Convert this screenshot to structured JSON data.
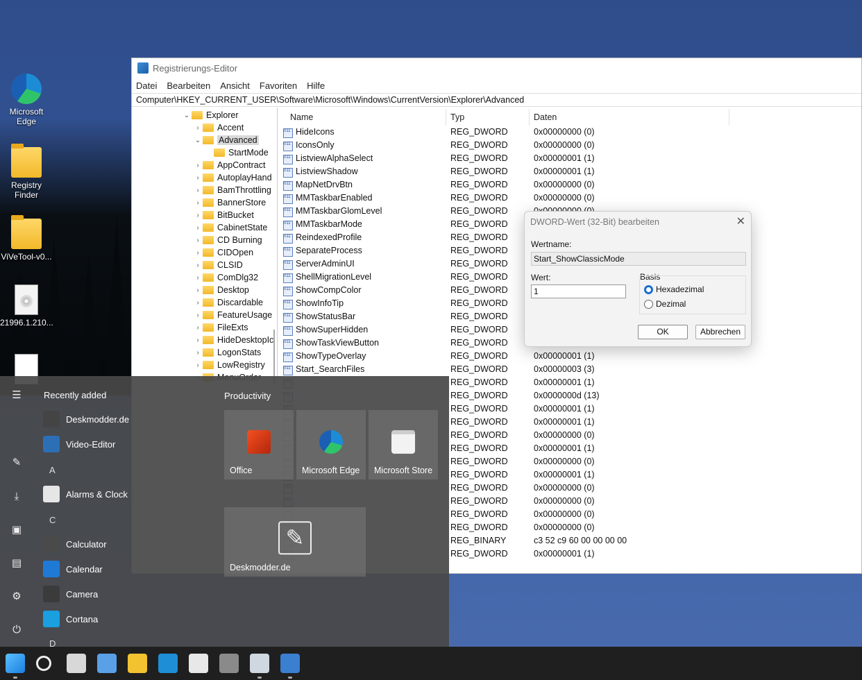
{
  "desktop": {
    "icons": [
      {
        "label": "Microsoft Edge",
        "icon": "edge-icon"
      },
      {
        "label": "Registry Finder",
        "icon": "folder-icon"
      },
      {
        "label": "ViVeTool-v0...",
        "icon": "folder-icon"
      },
      {
        "label": "21996.1.210...",
        "icon": "disc-image-icon"
      },
      {
        "label": "",
        "icon": "document-icon"
      }
    ]
  },
  "regedit": {
    "title": "Registrierungs-Editor",
    "menu": [
      "Datei",
      "Bearbeiten",
      "Ansicht",
      "Favoriten",
      "Hilfe"
    ],
    "address": "Computer\\HKEY_CURRENT_USER\\Software\\Microsoft\\Windows\\CurrentVersion\\Explorer\\Advanced",
    "tree": [
      {
        "label": "Explorer",
        "expanded": true,
        "level": 0
      },
      {
        "label": "Accent",
        "expanded": false,
        "level": 1
      },
      {
        "label": "Advanced",
        "expanded": true,
        "level": 1,
        "selected": true
      },
      {
        "label": "StartMode",
        "expanded": false,
        "level": 2
      },
      {
        "label": "AppContract",
        "expanded": false,
        "level": 1
      },
      {
        "label": "AutoplayHand",
        "expanded": false,
        "level": 1
      },
      {
        "label": "BamThrottling",
        "expanded": false,
        "level": 1
      },
      {
        "label": "BannerStore",
        "expanded": false,
        "level": 1
      },
      {
        "label": "BitBucket",
        "expanded": false,
        "level": 1
      },
      {
        "label": "CabinetState",
        "expanded": false,
        "level": 1
      },
      {
        "label": "CD Burning",
        "expanded": false,
        "level": 1
      },
      {
        "label": "CIDOpen",
        "expanded": false,
        "level": 1
      },
      {
        "label": "CLSID",
        "expanded": false,
        "level": 1
      },
      {
        "label": "ComDlg32",
        "expanded": false,
        "level": 1
      },
      {
        "label": "Desktop",
        "expanded": false,
        "level": 1
      },
      {
        "label": "Discardable",
        "expanded": false,
        "level": 1
      },
      {
        "label": "FeatureUsage",
        "expanded": false,
        "level": 1
      },
      {
        "label": "FileExts",
        "expanded": false,
        "level": 1
      },
      {
        "label": "HideDesktopIc",
        "expanded": false,
        "level": 1
      },
      {
        "label": "LogonStats",
        "expanded": false,
        "level": 1
      },
      {
        "label": "LowRegistry",
        "expanded": false,
        "level": 1
      },
      {
        "label": "MenuOrder",
        "expanded": false,
        "level": 1
      }
    ],
    "columns": {
      "name": "Name",
      "type": "Typ",
      "data": "Daten"
    },
    "values": [
      {
        "name": "HideIcons",
        "type": "REG_DWORD",
        "data": "0x00000000 (0)"
      },
      {
        "name": "IconsOnly",
        "type": "REG_DWORD",
        "data": "0x00000000 (0)"
      },
      {
        "name": "ListviewAlphaSelect",
        "type": "REG_DWORD",
        "data": "0x00000001 (1)"
      },
      {
        "name": "ListviewShadow",
        "type": "REG_DWORD",
        "data": "0x00000001 (1)"
      },
      {
        "name": "MapNetDrvBtn",
        "type": "REG_DWORD",
        "data": "0x00000000 (0)"
      },
      {
        "name": "MMTaskbarEnabled",
        "type": "REG_DWORD",
        "data": "0x00000000 (0)"
      },
      {
        "name": "MMTaskbarGlomLevel",
        "type": "REG_DWORD",
        "data": "0x00000000 (0)"
      },
      {
        "name": "MMTaskbarMode",
        "type": "REG_DWORD",
        "data": ""
      },
      {
        "name": "ReindexedProfile",
        "type": "REG_DWORD",
        "data": ""
      },
      {
        "name": "SeparateProcess",
        "type": "REG_DWORD",
        "data": ""
      },
      {
        "name": "ServerAdminUI",
        "type": "REG_DWORD",
        "data": ""
      },
      {
        "name": "ShellMigrationLevel",
        "type": "REG_DWORD",
        "data": ""
      },
      {
        "name": "ShowCompColor",
        "type": "REG_DWORD",
        "data": ""
      },
      {
        "name": "ShowInfoTip",
        "type": "REG_DWORD",
        "data": ""
      },
      {
        "name": "ShowStatusBar",
        "type": "REG_DWORD",
        "data": ""
      },
      {
        "name": "ShowSuperHidden",
        "type": "REG_DWORD",
        "data": ""
      },
      {
        "name": "ShowTaskViewButton",
        "type": "REG_DWORD",
        "data": ""
      },
      {
        "name": "ShowTypeOverlay",
        "type": "REG_DWORD",
        "data": "0x00000001 (1)"
      },
      {
        "name": "Start_SearchFiles",
        "type": "REG_DWORD",
        "data": "0x00000003 (3)"
      },
      {
        "name": "",
        "type": "REG_DWORD",
        "data": "0x00000001 (1)"
      },
      {
        "name": "",
        "type": "REG_DWORD",
        "data": "0x0000000d (13)"
      },
      {
        "name": "",
        "type": "REG_DWORD",
        "data": "0x00000001 (1)"
      },
      {
        "name": "",
        "type": "REG_DWORD",
        "data": "0x00000001 (1)"
      },
      {
        "name": "",
        "type": "REG_DWORD",
        "data": "0x00000000 (0)"
      },
      {
        "name": "",
        "type": "REG_DWORD",
        "data": "0x00000001 (1)"
      },
      {
        "name": "",
        "type": "REG_DWORD",
        "data": "0x00000000 (0)"
      },
      {
        "name": "",
        "type": "REG_DWORD",
        "data": "0x00000001 (1)"
      },
      {
        "name": "",
        "type": "REG_DWORD",
        "data": "0x00000000 (0)"
      },
      {
        "name": "",
        "type": "REG_DWORD",
        "data": "0x00000000 (0)"
      },
      {
        "name": "",
        "type": "REG_DWORD",
        "data": "0x00000000 (0)"
      },
      {
        "name": "",
        "type": "REG_DWORD",
        "data": "0x00000000 (0)"
      },
      {
        "name": "",
        "type": "REG_BINARY",
        "data": "c3 52 c9 60 00 00 00 00"
      },
      {
        "name": "",
        "type": "REG_DWORD",
        "data": "0x00000001 (1)"
      }
    ]
  },
  "dialog": {
    "title": "DWORD-Wert (32-Bit) bearbeiten",
    "name_label": "Wertname:",
    "name_value": "Start_ShowClassicMode",
    "value_label": "Wert:",
    "value_value": "1",
    "basis_label": "Basis",
    "radio_hex": "Hexadezimal",
    "radio_dec": "Dezimal",
    "selected_basis": "hex",
    "ok": "OK",
    "cancel": "Abbrechen"
  },
  "startmenu": {
    "recent_header": "Recently added",
    "apps": [
      {
        "label": "Deskmodder.de",
        "icon": "brush-icon",
        "color": "#444444"
      },
      {
        "label": "Video-Editor",
        "icon": "video-editor-icon",
        "color": "#2d6fb5"
      },
      {
        "letter": "A"
      },
      {
        "label": "Alarms & Clock",
        "icon": "clock-icon",
        "color": "#e6e6e6"
      },
      {
        "letter": "C"
      },
      {
        "label": "Calculator",
        "icon": "calculator-icon",
        "color": "#4a4a4a"
      },
      {
        "label": "Calendar",
        "icon": "calendar-icon",
        "color": "#1f7ad6"
      },
      {
        "label": "Camera",
        "icon": "camera-icon",
        "color": "#3b3b3b"
      },
      {
        "label": "Cortana",
        "icon": "cortana-icon",
        "color": "#1a9fe0"
      },
      {
        "letter": "D"
      }
    ],
    "tiles_title": "Productivity",
    "tiles": [
      {
        "label": "Office",
        "icon": "office-icon",
        "color": "#d83b01"
      },
      {
        "label": "Microsoft Edge",
        "icon": "edge-icon",
        "color": "#1e8fd6"
      },
      {
        "label": "Microsoft Store",
        "icon": "store-icon",
        "color": "#f2f2f2"
      },
      {
        "label": "Deskmodder.de",
        "icon": "brush-icon",
        "color": "#444444"
      }
    ]
  },
  "taskbar": {
    "icons": [
      "start-icon",
      "search-icon",
      "task-view-icon",
      "widgets-icon",
      "file-explorer-icon",
      "edge-icon",
      "store-icon",
      "settings-icon",
      "resource-monitor-icon",
      "regedit-icon"
    ]
  }
}
